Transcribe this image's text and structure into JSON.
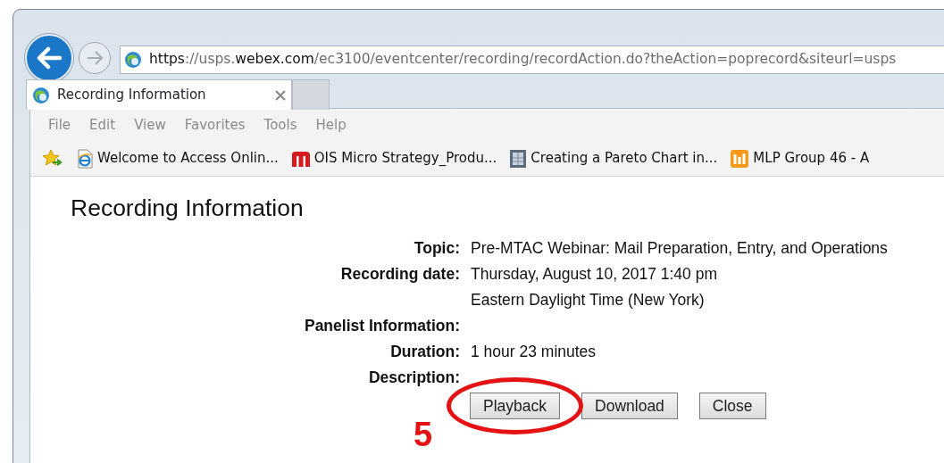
{
  "browser": {
    "address": [
      {
        "text": "https",
        "emphasis": true
      },
      {
        "text": "://usps.",
        "emphasis": false
      },
      {
        "text": "webex.com",
        "emphasis": true
      },
      {
        "text": "/ec3100/eventcenter/recording/recordAction.do?theAction=poprecord&siteurl=usps",
        "emphasis": false
      }
    ],
    "tabs": [
      {
        "title": "Recording Information",
        "selected": true
      }
    ],
    "menu": [
      "File",
      "Edit",
      "View",
      "Favorites",
      "Tools",
      "Help"
    ],
    "favorites": [
      {
        "kind": "ie",
        "label": "Welcome to Access Onlin..."
      },
      {
        "kind": "m",
        "label": "OIS Micro Strategy_Produ..."
      },
      {
        "kind": "page",
        "label": "Creating a Pareto Chart in..."
      },
      {
        "kind": "grid",
        "label": "MLP Group 46 - A"
      }
    ]
  },
  "page": {
    "title": "Recording Information",
    "fields": [
      {
        "label": "Topic:",
        "lines": [
          "Pre-MTAC Webinar: Mail Preparation, Entry, and Operations"
        ]
      },
      {
        "label": "Recording date:",
        "lines": [
          "Thursday, August 10, 2017 1:40 pm",
          "Eastern Daylight Time (New York)"
        ]
      },
      {
        "label": "Panelist Information:"
      },
      {
        "label": "Duration:",
        "lines": [
          "1 hour 23 minutes"
        ]
      },
      {
        "label": "Description:"
      }
    ],
    "buttons": [
      {
        "label": "Playback",
        "circled": true
      },
      {
        "label": "Download",
        "circled": false
      },
      {
        "label": "Close",
        "circled": false
      }
    ]
  },
  "annotation": {
    "text": "5"
  }
}
